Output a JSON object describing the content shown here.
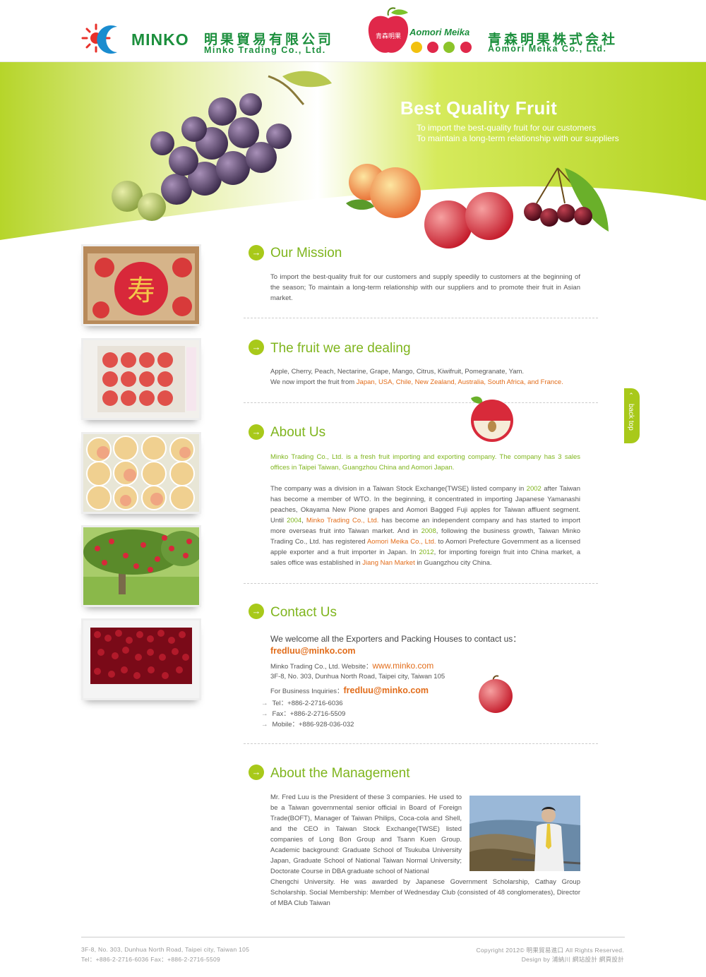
{
  "header": {
    "minko_word": "MINKO",
    "minko_cn": "明果貿易有限公司",
    "minko_en": "Minko Trading Co., Ltd.",
    "aomori_word": "Aomori Meika",
    "aomori_cn": "青森明果株式会社",
    "aomori_en": "Aomori Meika Co., Ltd.",
    "brand_green": "#1c8f3d"
  },
  "banner": {
    "title": "Best Quality Fruit",
    "line1": "To import the best-quality fruit for our customers",
    "line2": "To maintain a long-term relationship with our suppliers"
  },
  "colors": {
    "accent": "#a8c91a",
    "title_green": "#7fb51d",
    "highlight": "#e26d1b"
  },
  "sections": {
    "mission": {
      "title": "Our Mission",
      "text": "To import the best-quality fruit for our customers and supply speedily to customers at the beginning of the season; To maintain a long-term relationship with our suppliers and to promote their fruit in Asian market."
    },
    "fruit": {
      "title": "The fruit we are dealing",
      "line1": "Apple, Cherry, Peach, Nectarine, Grape, Mango, Citrus, Kiwifruit, Pomegranate, Yam.",
      "line2_prefix": "We now import the fruit from ",
      "line2_countries": "Japan, USA, Chile, New Zealand, Australia, South Africa, and France."
    },
    "about": {
      "title": "About Us",
      "intro": "Minko Trading Co., Ltd. is a fresh fruit importing and exporting company. The company has 3 sales offices in Taipei Taiwan, Guangzhou China and Aomori Japan.",
      "p1": "The company was a division in a Taiwan Stock Exchange(TWSE) listed company in ",
      "y2002": "2002",
      "p2": " after Taiwan has become a member of WTO. In the beginning, it concentrated in importing Japanese Yamanashi peaches, Okayama New Pione grapes and Aomori Bagged Fuji apples for Taiwan affluent segment. Until ",
      "y2004": "2004",
      "p3": ", ",
      "minko": "Minko Trading Co., Ltd.",
      "p4": " has become an independent company and has started to import more overseas fruit into Taiwan market. And in ",
      "y2008": "2008",
      "p5": ", following the business growth, Taiwan Minko Trading Co., Ltd. has registered ",
      "aomori": "Aomori Meika Co., Ltd.",
      "p6": " to Aomori Prefecture Government as a licensed apple exporter and a fruit importer in Japan. In ",
      "y2012": "2012",
      "p7": ", for importing foreign fruit into China market, a sales office was established in ",
      "jiangnan": "Jiang Nan Market",
      "p8": " in Guangzhou city China."
    },
    "contact": {
      "title": "Contact Us",
      "lead": "We welcome all the Exporters and Packing Houses to contact us：",
      "email": "fredluu@minko.com",
      "company": "Minko Trading Co., Ltd. Website：",
      "website": "www.minko.com",
      "address": "3F-8, No. 303, Dunhua North Road, Taipei city, Taiwan 105",
      "biz_label": "For Business Inquiries：",
      "biz_email": "fredluu@minko.com",
      "tel": "Tel：+886-2-2716-6036",
      "fax": "Fax：+886-2-2716-5509",
      "mobile": "Mobile：+886-928-036-032"
    },
    "management": {
      "title": "About the Management",
      "text1": "Mr. Fred Luu is the President of these 3 companies. He used to be a Taiwan governmental senior official in Board of Foreign Trade(BOFT), Manager of Taiwan Philips, Coca-cola and Shell, and the CEO in Taiwan Stock Exchange(TWSE) listed companies of Long Bon Group and Tsann Kuen Group. Academic background: Graduate School of Tsukuba University Japan, Graduate School of National Taiwan Normal University; Doctorate Course in DBA graduate school of National",
      "text2": "Chengchi University. He was awarded by Japanese Government Scholarship, Cathay Group Scholarship. Social Membership: Member of Wednesday Club (consisted of 48 conglomerates), Director of MBA Club Taiwan"
    }
  },
  "back_top": "back top",
  "footer": {
    "left1": "3F-8, No. 303, Dunhua North Road, Taipei city, Taiwan 105",
    "left2": "Tel：+886-2-2716-6036     Fax：+886-2-2716-5509",
    "right1": "Copyright 2012© 明果貿易進口  All Rights Reserved.",
    "right2": "Design by 浦納川 網站設計 網頁設計"
  },
  "aomori_badge": "青森明果"
}
